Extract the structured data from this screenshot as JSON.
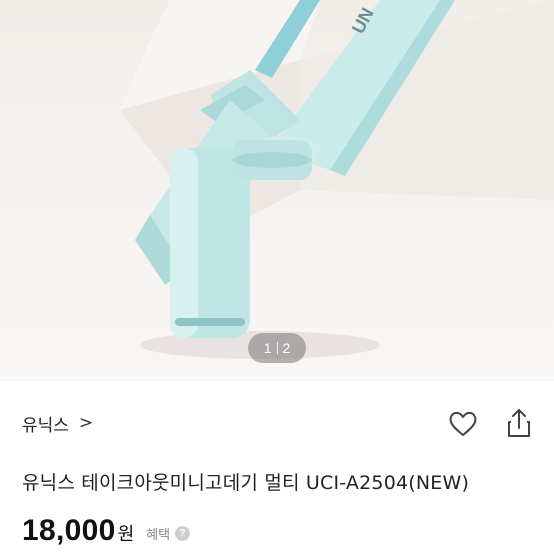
{
  "gallery": {
    "current": "1",
    "total": "2",
    "product_print": "UN"
  },
  "product": {
    "brand": "유닉스",
    "brand_chevron": ">",
    "title": "유닉스 테이크아웃미니고데기 멀티 UCI-A2504(NEW)",
    "price": "18,000",
    "currency": "원",
    "benefit_label": "혜택",
    "info_icon": "?"
  },
  "icons": {
    "favorite": "heart-icon",
    "share": "share-icon"
  },
  "colors": {
    "device_mint": "#c9ebea",
    "device_shadow": "#9fd3d3"
  }
}
